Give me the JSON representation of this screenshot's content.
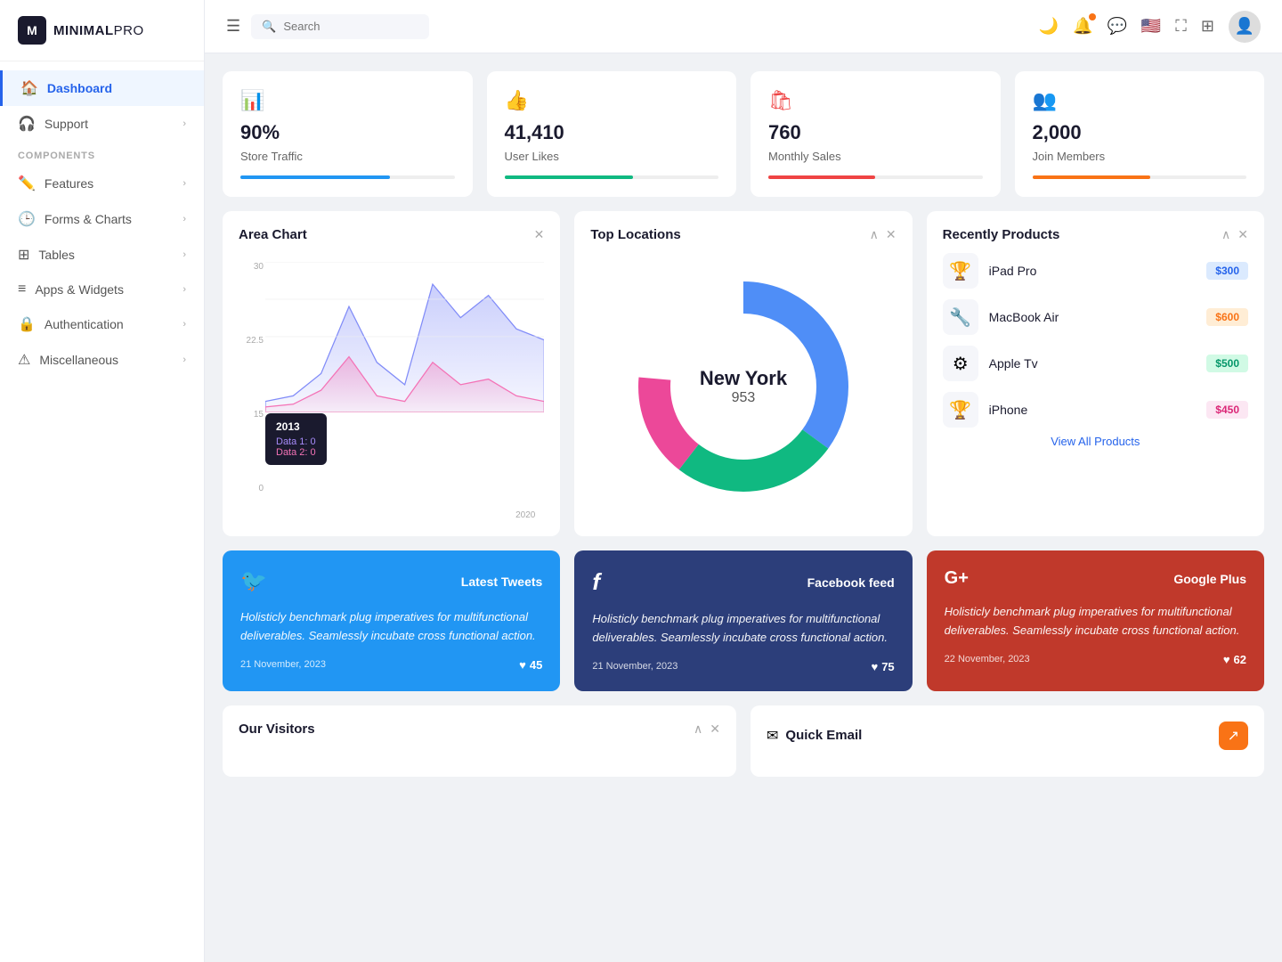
{
  "app": {
    "name_bold": "MINIMAL",
    "name_light": "PRO"
  },
  "header": {
    "search_placeholder": "Search",
    "hamburger_label": "☰"
  },
  "sidebar": {
    "nav_items": [
      {
        "id": "dashboard",
        "label": "Dashboard",
        "icon": "🏠",
        "active": true
      },
      {
        "id": "support",
        "label": "Support",
        "icon": "🎧",
        "has_chevron": true
      },
      {
        "id": "features",
        "label": "Features",
        "icon": "✏️",
        "has_chevron": true
      },
      {
        "id": "forms-charts",
        "label": "Forms & Charts",
        "icon": "🕒",
        "has_chevron": true
      },
      {
        "id": "tables",
        "label": "Tables",
        "icon": "⊞",
        "has_chevron": true
      },
      {
        "id": "apps-widgets",
        "label": "Apps & Widgets",
        "icon": "≡",
        "has_chevron": true
      },
      {
        "id": "authentication",
        "label": "Authentication",
        "icon": "🔒",
        "has_chevron": true
      },
      {
        "id": "miscellaneous",
        "label": "Miscellaneous",
        "icon": "⚠",
        "has_chevron": true
      }
    ],
    "components_label": "Components"
  },
  "stats": [
    {
      "id": "store-traffic",
      "icon": "📊",
      "icon_color": "#2196f3",
      "value": "90%",
      "label": "Store Traffic",
      "bar_color": "#2196f3",
      "bar_width": "70%"
    },
    {
      "id": "user-likes",
      "icon": "👍",
      "icon_color": "#10b981",
      "value": "41,410",
      "label": "User Likes",
      "bar_color": "#10b981",
      "bar_width": "60%"
    },
    {
      "id": "monthly-sales",
      "icon": "🛍",
      "icon_color": "#ef4444",
      "value": "760",
      "label": "Monthly Sales",
      "bar_color": "#ef4444",
      "bar_width": "50%"
    },
    {
      "id": "join-members",
      "icon": "👥",
      "icon_color": "#f97316",
      "value": "2,000",
      "label": "Join Members",
      "bar_color": "#f97316",
      "bar_width": "55%"
    }
  ],
  "area_chart": {
    "title": "Area Chart",
    "y_labels": [
      "30",
      "22.5",
      "15",
      "0"
    ],
    "x_label": "2020",
    "tooltip": {
      "year": "2013",
      "data1_label": "Data 1: 0",
      "data2_label": "Data 2: 0"
    }
  },
  "top_locations": {
    "title": "Top Locations",
    "city": "New York",
    "count": "953"
  },
  "recently_products": {
    "title": "Recently Products",
    "items": [
      {
        "name": "iPad Pro",
        "icon": "🏆",
        "price": "$300",
        "price_class": "price-blue"
      },
      {
        "name": "MacBook Air",
        "icon": "🔧",
        "price": "$600",
        "price_class": "price-orange"
      },
      {
        "name": "Apple Tv",
        "icon": "⚙",
        "price": "$500",
        "price_class": "price-teal"
      },
      {
        "name": "iPhone",
        "icon": "🏆",
        "price": "$450",
        "price_class": "price-pink"
      }
    ],
    "view_all": "View All Products"
  },
  "social": [
    {
      "id": "twitter",
      "platform": "twitter",
      "logo": "🐦",
      "title": "Latest Tweets",
      "text": "Holisticly benchmark plug imperatives for multifunctional deliverables. Seamlessly incubate cross functional action.",
      "date": "21 November, 2023",
      "likes": "45"
    },
    {
      "id": "facebook",
      "platform": "facebook",
      "logo": "f",
      "title": "Facebook feed",
      "text": "Holisticly benchmark plug imperatives for multifunctional deliverables. Seamlessly incubate cross functional action.",
      "date": "21 November, 2023",
      "likes": "75"
    },
    {
      "id": "google",
      "platform": "google",
      "logo": "G+",
      "title": "Google Plus",
      "text": "Holisticly benchmark plug imperatives for multifunctional deliverables. Seamlessly incubate cross functional action.",
      "date": "22 November, 2023",
      "likes": "62"
    }
  ],
  "bottom": {
    "visitors_title": "Our Visitors",
    "quick_email_title": "Quick Email"
  }
}
